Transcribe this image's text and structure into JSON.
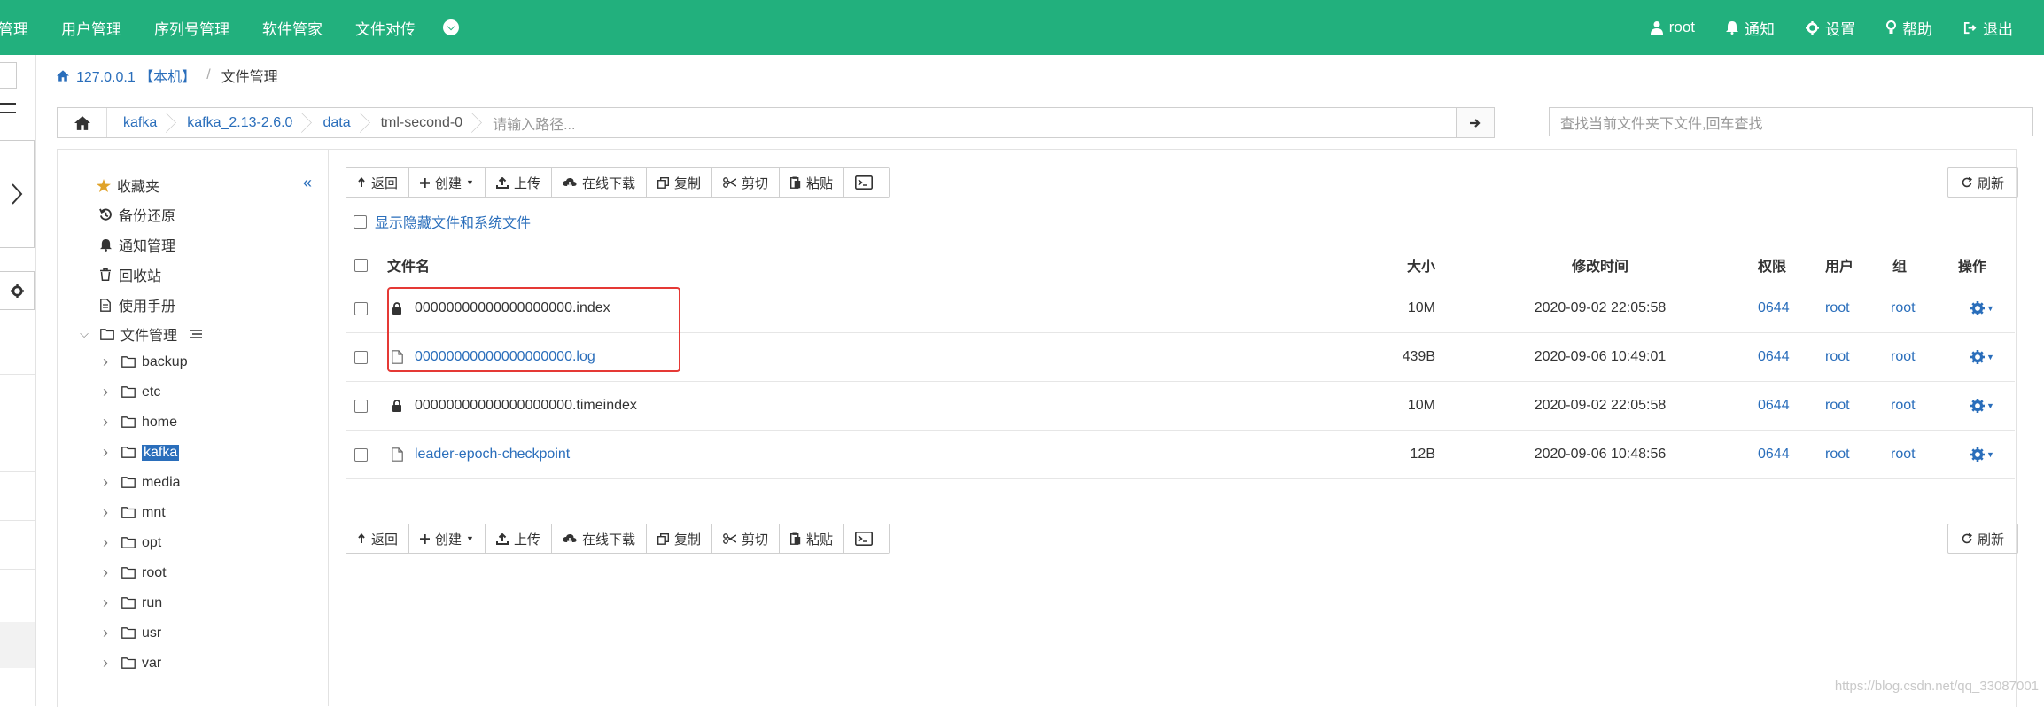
{
  "topnav": {
    "items": [
      "管理",
      "用户管理",
      "序列号管理",
      "软件管家",
      "文件对传"
    ],
    "more_icon": "chevron-down-circle-icon",
    "right": [
      {
        "icon": "user-icon",
        "label": "root"
      },
      {
        "icon": "bell-icon",
        "label": "通知"
      },
      {
        "icon": "gear-icon",
        "label": "设置"
      },
      {
        "icon": "bulb-icon",
        "label": "帮助"
      },
      {
        "icon": "logout-icon",
        "label": "退出"
      }
    ],
    "bg_color": "#22b07d"
  },
  "breadcrumb": {
    "host": "127.0.0.1 【本机】",
    "separator": "/",
    "current": "文件管理"
  },
  "pathbar": {
    "segments": [
      "kafka",
      "kafka_2.13-2.6.0",
      "data",
      "tml-second-0"
    ],
    "placeholder": "请输入路径...",
    "search_placeholder": "查找当前文件夹下文件,回车查找"
  },
  "sidebar": {
    "collapse": "«",
    "items": [
      {
        "icon": "star-icon",
        "label": "收藏夹"
      },
      {
        "icon": "history-icon",
        "label": "备份还原"
      },
      {
        "icon": "bell-icon",
        "label": "通知管理"
      },
      {
        "icon": "trash-icon",
        "label": "回收站"
      },
      {
        "icon": "doc-icon",
        "label": "使用手册"
      }
    ],
    "file_manager_label": "文件管理",
    "folders": [
      "backup",
      "etc",
      "home",
      "kafka",
      "media",
      "mnt",
      "opt",
      "root",
      "run",
      "usr",
      "var"
    ],
    "selected_folder": "kafka"
  },
  "toolbar": {
    "buttons": [
      "返回",
      "创建",
      "上传",
      "在线下载",
      "复制",
      "剪切",
      "粘贴"
    ],
    "refresh": "刷新"
  },
  "hidden_files_label": "显示隐藏文件和系统文件",
  "table": {
    "headers": {
      "name": "文件名",
      "size": "大小",
      "mtime": "修改时间",
      "perm": "权限",
      "user": "用户",
      "group": "组",
      "op": "操作"
    },
    "rows": [
      {
        "name": "00000000000000000000.index",
        "icon": "lock-icon",
        "link": false,
        "size": "10M",
        "mtime": "2020-09-02 22:05:58",
        "perm": "0644",
        "user": "root",
        "group": "root"
      },
      {
        "name": "00000000000000000000.log",
        "icon": "file-icon",
        "link": true,
        "size": "439B",
        "mtime": "2020-09-06 10:49:01",
        "perm": "0644",
        "user": "root",
        "group": "root"
      },
      {
        "name": "00000000000000000000.timeindex",
        "icon": "lock-icon",
        "link": false,
        "size": "10M",
        "mtime": "2020-09-02 22:05:58",
        "perm": "0644",
        "user": "root",
        "group": "root"
      },
      {
        "name": "leader-epoch-checkpoint",
        "icon": "file-icon",
        "link": true,
        "size": "12B",
        "mtime": "2020-09-06 10:48:56",
        "perm": "0644",
        "user": "root",
        "group": "root"
      }
    ]
  },
  "watermark": "https://blog.csdn.net/qq_33087001"
}
